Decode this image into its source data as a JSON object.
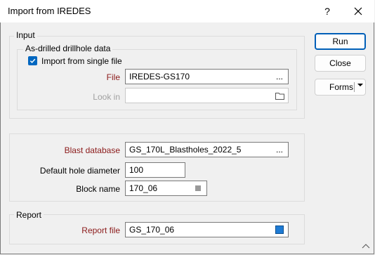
{
  "window": {
    "title": "Import from IREDES",
    "help_label": "?"
  },
  "input_group": {
    "label": "Input",
    "subgroup_label": "As-drilled drillhole data",
    "checkbox_label": "Import from single file",
    "checkbox_checked": true,
    "file_label": "File",
    "file_value": "IREDES-GS170",
    "file_browse": "...",
    "lookin_label": "Look in",
    "lookin_value": ""
  },
  "blast_group": {
    "blast_db_label": "Blast database",
    "blast_db_value": "GS_170L_Blastholes_2022_5",
    "blast_db_browse": "...",
    "diameter_label": "Default hole diameter",
    "diameter_value": "100",
    "block_label": "Block name",
    "block_value": "170_06"
  },
  "report_group": {
    "label": "Report",
    "report_file_label": "Report file",
    "report_file_value": "GS_170_06"
  },
  "buttons": {
    "run": "Run",
    "close": "Close",
    "forms": "Forms"
  },
  "colors": {
    "required_label": "#8b1a1a",
    "accent": "#0067c0",
    "report_swatch": "#1e7bd4"
  }
}
